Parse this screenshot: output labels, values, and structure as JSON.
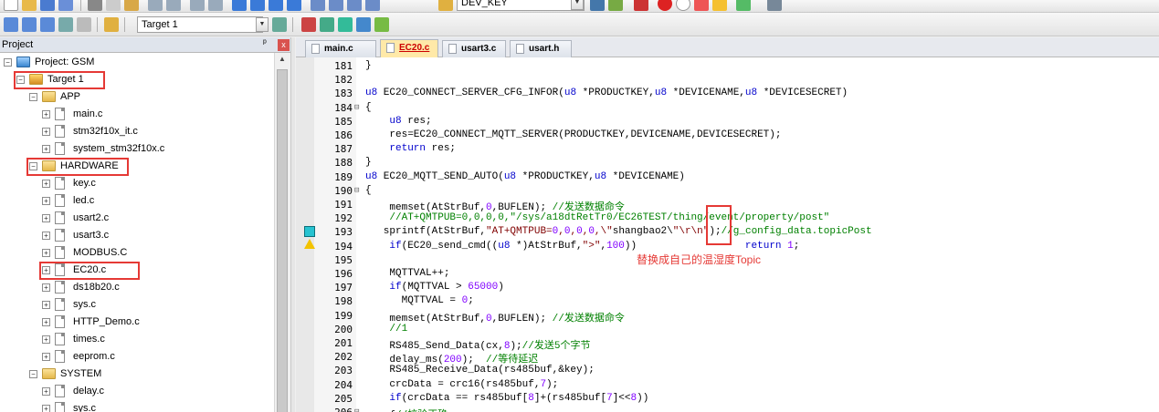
{
  "toolbar": {
    "target_select": "Target 1",
    "find_select": "DEV_KEY"
  },
  "project_panel": {
    "title": "Project",
    "pin": "ᵖ",
    "close": "x",
    "tree": [
      {
        "label": "Project: GSM",
        "level": 0,
        "kind": "project",
        "expander": "−"
      },
      {
        "label": "Target 1",
        "level": 1,
        "kind": "target",
        "expander": "−",
        "highlight": true
      },
      {
        "label": "APP",
        "level": 2,
        "kind": "folder",
        "expander": "−"
      },
      {
        "label": "main.c",
        "level": 3,
        "kind": "file",
        "expander": "+"
      },
      {
        "label": "stm32f10x_it.c",
        "level": 3,
        "kind": "file",
        "expander": "+"
      },
      {
        "label": "system_stm32f10x.c",
        "level": 3,
        "kind": "file",
        "expander": "+"
      },
      {
        "label": "HARDWARE",
        "level": 2,
        "kind": "folder",
        "expander": "−",
        "highlight": true
      },
      {
        "label": "key.c",
        "level": 3,
        "kind": "file",
        "expander": "+"
      },
      {
        "label": "led.c",
        "level": 3,
        "kind": "file",
        "expander": "+"
      },
      {
        "label": "usart2.c",
        "level": 3,
        "kind": "file",
        "expander": "+"
      },
      {
        "label": "usart3.c",
        "level": 3,
        "kind": "file",
        "expander": "+"
      },
      {
        "label": "MODBUS.C",
        "level": 3,
        "kind": "file",
        "expander": "+"
      },
      {
        "label": "EC20.c",
        "level": 3,
        "kind": "file",
        "expander": "+",
        "highlight": true
      },
      {
        "label": "ds18b20.c",
        "level": 3,
        "kind": "file",
        "expander": "+"
      },
      {
        "label": "sys.c",
        "level": 3,
        "kind": "file",
        "expander": "+"
      },
      {
        "label": "HTTP_Demo.c",
        "level": 3,
        "kind": "file",
        "expander": "+"
      },
      {
        "label": "times.c",
        "level": 3,
        "kind": "file",
        "expander": "+"
      },
      {
        "label": "eeprom.c",
        "level": 3,
        "kind": "file",
        "expander": "+"
      },
      {
        "label": "SYSTEM",
        "level": 2,
        "kind": "folder",
        "expander": "−"
      },
      {
        "label": "delay.c",
        "level": 3,
        "kind": "file",
        "expander": "+"
      },
      {
        "label": "sys.c",
        "level": 3,
        "kind": "file",
        "expander": "+"
      }
    ]
  },
  "editor_tabs": [
    {
      "label": "main.c",
      "active": false
    },
    {
      "label": "EC20.c",
      "active": true
    },
    {
      "label": "usart3.c",
      "active": false
    },
    {
      "label": "usart.h",
      "active": false
    }
  ],
  "code_lines": [
    {
      "n": "181",
      "fold": "",
      "text": "}"
    },
    {
      "n": "182",
      "fold": "",
      "text": ""
    },
    {
      "n": "183",
      "fold": "",
      "text": "u8 EC20_CONNECT_SERVER_CFG_INFOR(u8 *PRODUCTKEY,u8 *DEVICENAME,u8 *DEVICESECRET)"
    },
    {
      "n": "184",
      "fold": "⊟",
      "text": "{"
    },
    {
      "n": "185",
      "fold": "",
      "text": "    u8 res;"
    },
    {
      "n": "186",
      "fold": "",
      "text": "    res=EC20_CONNECT_MQTT_SERVER(PRODUCTKEY,DEVICENAME,DEVICESECRET);"
    },
    {
      "n": "187",
      "fold": "",
      "text": "    return res;"
    },
    {
      "n": "188",
      "fold": "",
      "text": "}"
    },
    {
      "n": "189",
      "fold": "",
      "text": "u8 EC20_MQTT_SEND_AUTO(u8 *PRODUCTKEY,u8 *DEVICENAME)"
    },
    {
      "n": "190",
      "fold": "⊟",
      "text": "{"
    },
    {
      "n": "191",
      "fold": "",
      "text": "    memset(AtStrBuf,0,BUFLEN); //发送数据命令"
    },
    {
      "n": "192",
      "fold": "",
      "text": "    //AT+QMTPUB=0,0,0,0,\"/sys/a18dtRetTr0/EC26TEST/thing/event/property/post\""
    },
    {
      "n": "193",
      "fold": "",
      "text": "   sprintf(AtStrBuf,\"AT+QMTPUB=0,0,0,0,\\\"shangbao2\\\"\\r\\n\");//g_config_data.topicPost"
    },
    {
      "n": "194",
      "fold": "",
      "text": "    if(EC20_send_cmd((u8 *)AtStrBuf,\">\",100))                  return 1;"
    },
    {
      "n": "195",
      "fold": "",
      "text": ""
    },
    {
      "n": "196",
      "fold": "",
      "text": "    MQTTVAL++;"
    },
    {
      "n": "197",
      "fold": "",
      "text": "    if(MQTTVAL > 65000)"
    },
    {
      "n": "198",
      "fold": "",
      "text": "      MQTTVAL = 0;"
    },
    {
      "n": "199",
      "fold": "",
      "text": "    memset(AtStrBuf,0,BUFLEN); //发送数据命令"
    },
    {
      "n": "200",
      "fold": "",
      "text": "    //1"
    },
    {
      "n": "201",
      "fold": "",
      "text": "    RS485_Send_Data(cx,8);//发送5个字节"
    },
    {
      "n": "202",
      "fold": "",
      "text": "    delay_ms(200);  //等待延迟"
    },
    {
      "n": "203",
      "fold": "",
      "text": "    RS485_Receive_Data(rs485buf,&key);"
    },
    {
      "n": "204",
      "fold": "",
      "text": "    crcData = crc16(rs485buf,7);"
    },
    {
      "n": "205",
      "fold": "",
      "text": "    if(crcData == rs485buf[8]+(rs485buf[7]<<8))"
    },
    {
      "n": "206",
      "fold": "⊟",
      "text": "    {//校验正确"
    }
  ],
  "annotation": "替换成自己的温湿度Topic",
  "colors": {
    "highlight_red": "#e53935",
    "comment_green": "#008000",
    "keyword_blue": "#0000cc",
    "active_tab": "#ffe9a8"
  }
}
